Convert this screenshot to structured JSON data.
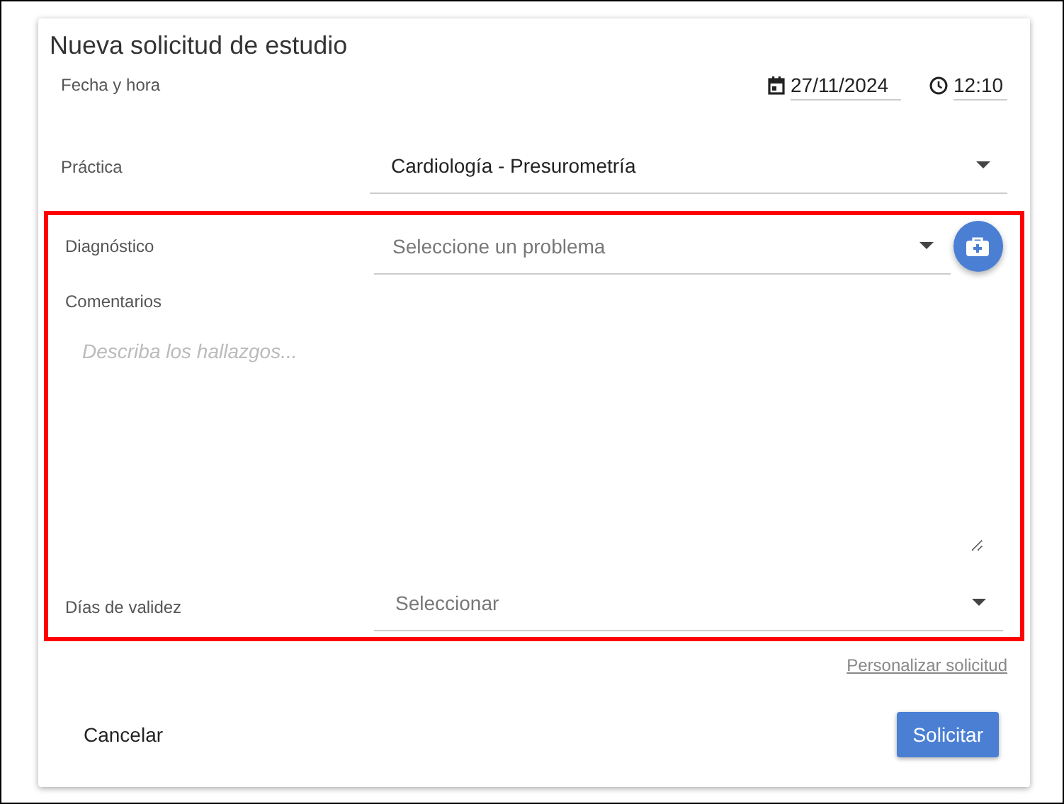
{
  "dialog": {
    "title": "Nueva solicitud de estudio"
  },
  "date_time": {
    "label": "Fecha y hora",
    "date": "27/11/2024",
    "time": "12:10"
  },
  "practice": {
    "label": "Práctica",
    "value": "Cardiología - Presurometría"
  },
  "diagnosis": {
    "label": "Diagnóstico",
    "placeholder": "Seleccione un problema"
  },
  "comments": {
    "label": "Comentarios",
    "placeholder": "Describa los hallazgos..."
  },
  "validity": {
    "label": "Días de validez",
    "placeholder": "Seleccionar"
  },
  "customize_link": "Personalizar solicitud",
  "buttons": [
    {
      "label": "Cancelar",
      "kind": "flat"
    },
    {
      "label": "Solicitar",
      "kind": "primary"
    }
  ]
}
